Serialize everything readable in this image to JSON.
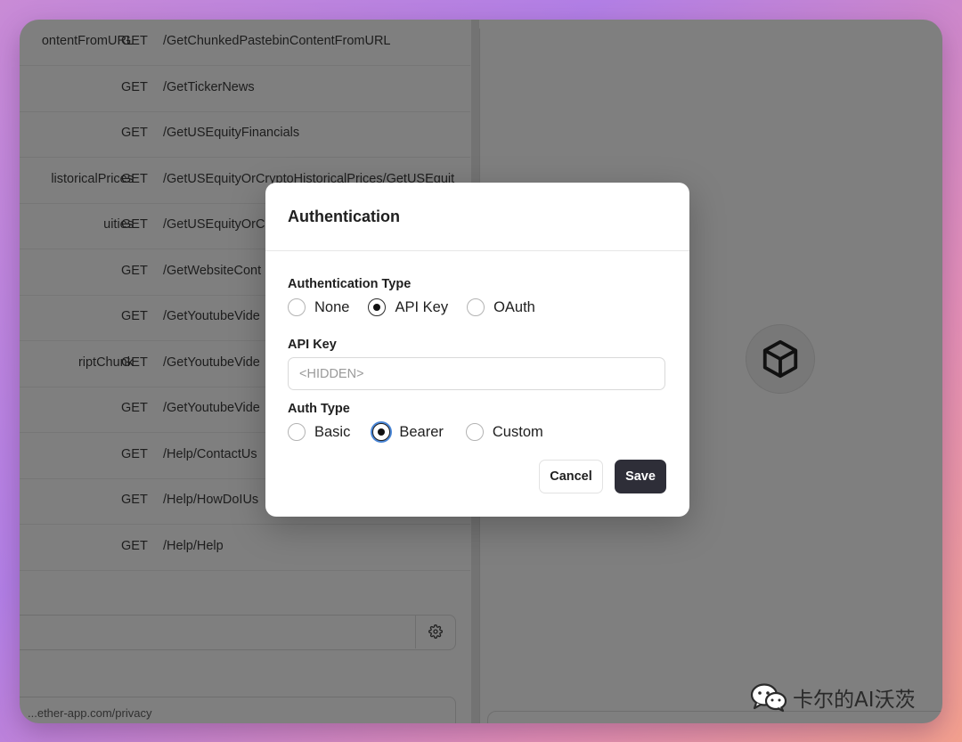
{
  "endpoints": [
    {
      "name": "ontentFromURL",
      "method": "GET",
      "path": "/GetChunkedPastebinContentFromURL"
    },
    {
      "name": "",
      "method": "GET",
      "path": "/GetTickerNews"
    },
    {
      "name": "",
      "method": "GET",
      "path": "/GetUSEquityFinancials"
    },
    {
      "name": "listoricalPrices",
      "method": "GET",
      "path": "/GetUSEquityOrCryptoHistoricalPrices/GetUSEquit"
    },
    {
      "name": "uities",
      "method": "GET",
      "path": "/GetUSEquityOrC"
    },
    {
      "name": "",
      "method": "GET",
      "path": "/GetWebsiteCont"
    },
    {
      "name": "",
      "method": "GET",
      "path": "/GetYoutubeVide"
    },
    {
      "name": "riptChunk",
      "method": "GET",
      "path": "/GetYoutubeVide"
    },
    {
      "name": "",
      "method": "GET",
      "path": "/GetYoutubeVide"
    },
    {
      "name": "",
      "method": "GET",
      "path": "/Help/ContactUs"
    },
    {
      "name": "",
      "method": "GET",
      "path": "/Help/HowDoIUs"
    },
    {
      "name": "",
      "method": "GET",
      "path": "/Help/Help"
    }
  ],
  "privacy_text": "...ether-app.com/privacy",
  "modal": {
    "title": "Authentication",
    "auth_type_label": "Authentication Type",
    "auth_type_options": [
      "None",
      "API Key",
      "OAuth"
    ],
    "auth_type_selected": "API Key",
    "api_key_label": "API Key",
    "api_key_placeholder": "<HIDDEN>",
    "auth_kind_label": "Auth Type",
    "auth_kind_options": [
      "Basic",
      "Bearer",
      "Custom"
    ],
    "auth_kind_selected": "Bearer",
    "cancel_label": "Cancel",
    "save_label": "Save"
  },
  "watermark": "卡尔的AI沃茨",
  "colors": {
    "overlay": "#7f7f7f",
    "save_button": "#2e2e38",
    "focus_ring": "#4a86d6"
  },
  "icons": [
    "gear-icon",
    "cube-icon",
    "wechat-icon"
  ]
}
